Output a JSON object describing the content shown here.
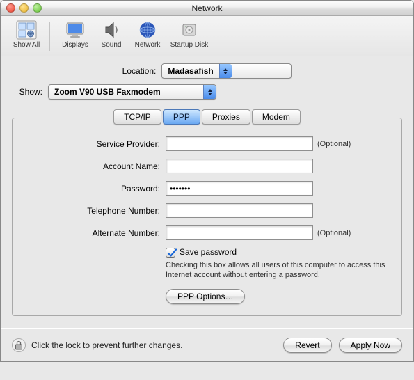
{
  "window": {
    "title": "Network"
  },
  "toolbar": {
    "show_all": "Show All",
    "displays": "Displays",
    "sound": "Sound",
    "network": "Network",
    "startup_disk": "Startup Disk"
  },
  "location": {
    "label": "Location:",
    "value": "Madasafish"
  },
  "show": {
    "label": "Show:",
    "value": "Zoom V90 USB Faxmodem"
  },
  "tabs": {
    "tcpip": "TCP/IP",
    "ppp": "PPP",
    "proxies": "Proxies",
    "modem": "Modem"
  },
  "form": {
    "service_provider": {
      "label": "Service Provider:",
      "value": "",
      "optional": "(Optional)"
    },
    "account_name": {
      "label": "Account Name:",
      "value": ""
    },
    "password": {
      "label": "Password:",
      "value": "•••••••"
    },
    "telephone": {
      "label": "Telephone Number:",
      "value": ""
    },
    "alternate": {
      "label": "Alternate Number:",
      "value": "",
      "optional": "(Optional)"
    },
    "save_password": {
      "label": "Save password",
      "desc": "Checking this box allows all users of this computer to access this Internet account without entering a password."
    },
    "ppp_options": "PPP Options…"
  },
  "footer": {
    "lock_text": "Click the lock to prevent further changes.",
    "revert": "Revert",
    "apply": "Apply Now"
  }
}
